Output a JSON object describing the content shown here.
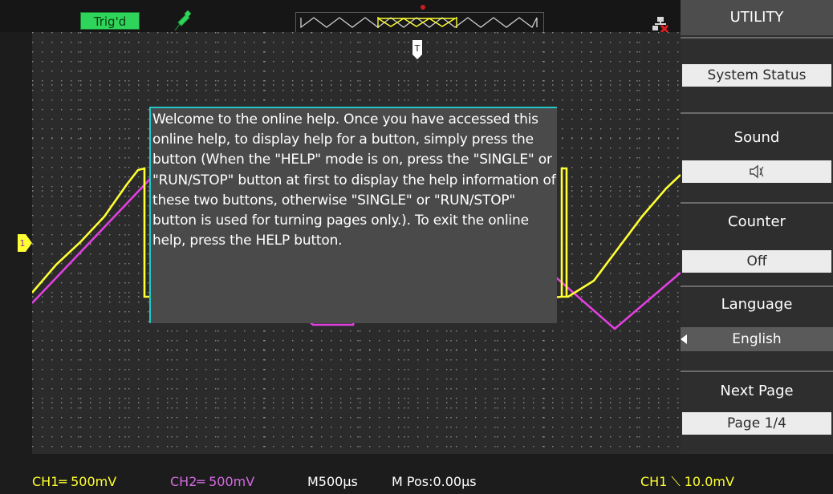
{
  "top_bar": {
    "trigger_status": "Trig'd",
    "icons": [
      "probe-icon",
      "timebase-strip",
      "network-disconnected-icon"
    ],
    "trigger_marker_label": "T"
  },
  "help_overlay": {
    "text": "Welcome to the online help. Once you have accessed this online help, to display help for a button, simply press the button (When the \"HELP\" mode is on, press the \"SINGLE\" or \"RUN/STOP\" button at first to display the help information of these two buttons, otherwise \"SINGLE\" or \"RUN/STOP\" button is used for turning pages only.). To exit the online help, press the HELP button."
  },
  "menu": {
    "title": "UTILITY",
    "items": [
      {
        "label": "",
        "value": "System Status"
      },
      {
        "label": "Sound",
        "value": "speaker-icon"
      },
      {
        "label": "Counter",
        "value": "Off"
      },
      {
        "label": "Language",
        "value": "English"
      },
      {
        "label": "Next Page",
        "value": "Page 1/4"
      }
    ]
  },
  "status_bar": {
    "ch1": "CH1═ 500mV",
    "ch2": "CH2═ 500mV",
    "timebase": "M500µs",
    "position": "M Pos:0.00µs",
    "trigger": "CH1 ⟍ 10.0mV"
  },
  "channel_marker": "1",
  "colors": {
    "ch1": "#ffff33",
    "ch2": "#e040e0",
    "trig_badge": "#2fd55a",
    "help_border": "#24c6c8",
    "menu_bg": "#2e2e2e",
    "menu_value_bg": "#ececec"
  }
}
